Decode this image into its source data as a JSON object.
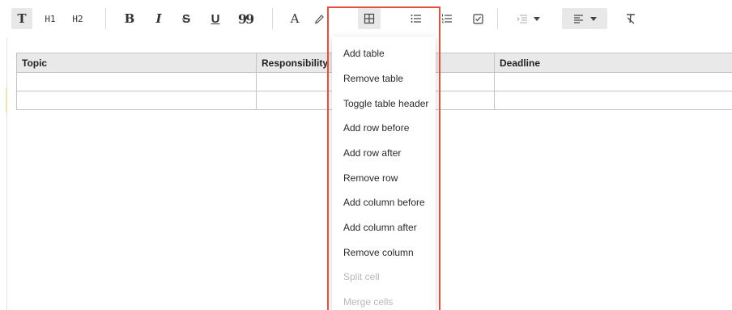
{
  "toolbar": {
    "text_label": "T",
    "h1_label": "H1",
    "h2_label": "H2",
    "bold_label": "B",
    "italic_label": "I",
    "strike_label": "S",
    "underline_label": "U",
    "quote_label": "99",
    "font_color_label": "A",
    "icons": [
      "table-icon",
      "bullet-list-icon",
      "numbered-list-icon",
      "checklist-icon",
      "indent-icon",
      "align-left-icon",
      "clear-format-icon",
      "highlight-pen-icon"
    ]
  },
  "table": {
    "headers": [
      "Topic",
      "Responsibility",
      "",
      "Deadline"
    ],
    "rows": [
      [
        "",
        "",
        "",
        ""
      ],
      [
        "",
        "",
        "",
        ""
      ]
    ]
  },
  "table_menu": {
    "items": [
      {
        "label": "Add table",
        "enabled": true
      },
      {
        "label": "Remove table",
        "enabled": true
      },
      {
        "label": "Toggle table header",
        "enabled": true
      },
      {
        "label": "Add row before",
        "enabled": true
      },
      {
        "label": "Add row after",
        "enabled": true
      },
      {
        "label": "Remove row",
        "enabled": true
      },
      {
        "label": "Add column before",
        "enabled": true
      },
      {
        "label": "Add column after",
        "enabled": true
      },
      {
        "label": "Remove column",
        "enabled": true
      },
      {
        "label": "Split cell",
        "enabled": false
      },
      {
        "label": "Merge cells",
        "enabled": false
      }
    ]
  },
  "colors": {
    "highlight_border": "#e2503c",
    "header_bg": "#e9e9e9",
    "disabled_text": "#b8b8b8"
  }
}
